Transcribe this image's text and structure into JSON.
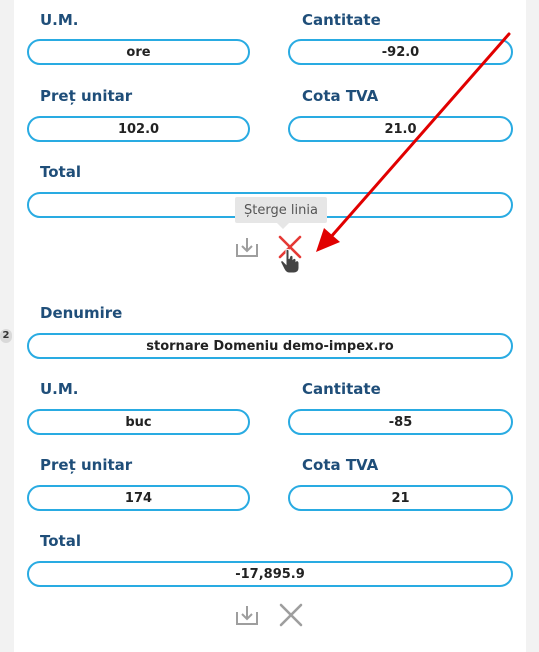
{
  "line1": {
    "um_label": "U.M.",
    "um_value": "ore",
    "qty_label": "Cantitate",
    "qty_value": "-92.0",
    "price_label": "Preț unitar",
    "price_value": "102.0",
    "vat_label": "Cota TVA",
    "vat_value": "21.0",
    "total_label": "Total",
    "total_value": "",
    "delete_tooltip": "Șterge linia"
  },
  "line2": {
    "index": "2",
    "name_label": "Denumire",
    "name_value": "stornare Domeniu demo-impex.ro",
    "um_label": "U.M.",
    "um_value": "buc",
    "qty_label": "Cantitate",
    "qty_value": "-85",
    "price_label": "Preț unitar",
    "price_value": "174",
    "vat_label": "Cota TVA",
    "vat_value": "21",
    "total_label": "Total",
    "total_value": "-17,895.9"
  },
  "colors": {
    "label": "#1f4e79",
    "field_border": "#29abe2",
    "delete_active": "#e53935",
    "icon_idle": "#9e9e9e",
    "annotation_arrow": "#e10000"
  },
  "icons": {
    "save": "download-tray-icon",
    "delete": "close-x-icon",
    "cursor": "hand-pointer-icon"
  }
}
